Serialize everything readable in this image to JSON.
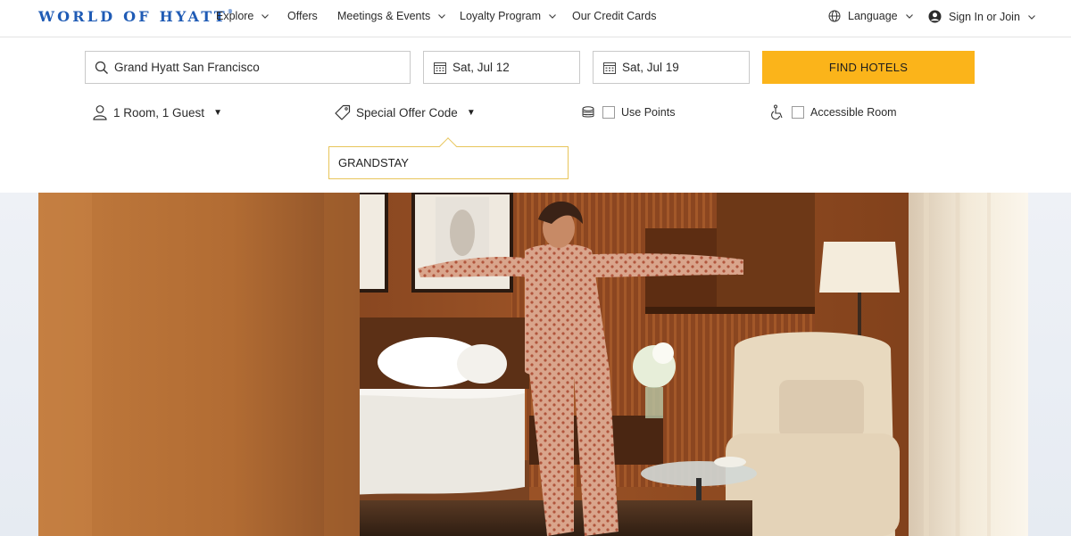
{
  "brand": {
    "logo_text": "WORLD OF HYATT",
    "logo_mark": "®",
    "color": "#1f5bb5"
  },
  "nav": {
    "items": [
      {
        "label": "Explore",
        "has_dropdown": true
      },
      {
        "label": "Offers",
        "has_dropdown": false
      },
      {
        "label": "Meetings & Events",
        "has_dropdown": true
      },
      {
        "label": "Loyalty Program",
        "has_dropdown": true
      },
      {
        "label": "Our Credit Cards",
        "has_dropdown": false
      }
    ],
    "language": "Language",
    "sign_in": "Sign In or Join"
  },
  "search": {
    "destination": "Grand Hyatt San Francisco",
    "check_in": "Sat, Jul 12",
    "check_out": "Sat, Jul 19",
    "find_label": "FIND HOTELS",
    "accent": "#fbb41a"
  },
  "options": {
    "rooms_guests": "1 Room, 1 Guest",
    "offer_code_label": "Special Offer Code",
    "offer_code_value": "GRANDSTAY",
    "use_points": "Use Points",
    "use_points_checked": false,
    "accessible_room": "Accessible Room",
    "accessible_checked": false
  },
  "hero": {
    "icon": "hotel-room-photo"
  }
}
